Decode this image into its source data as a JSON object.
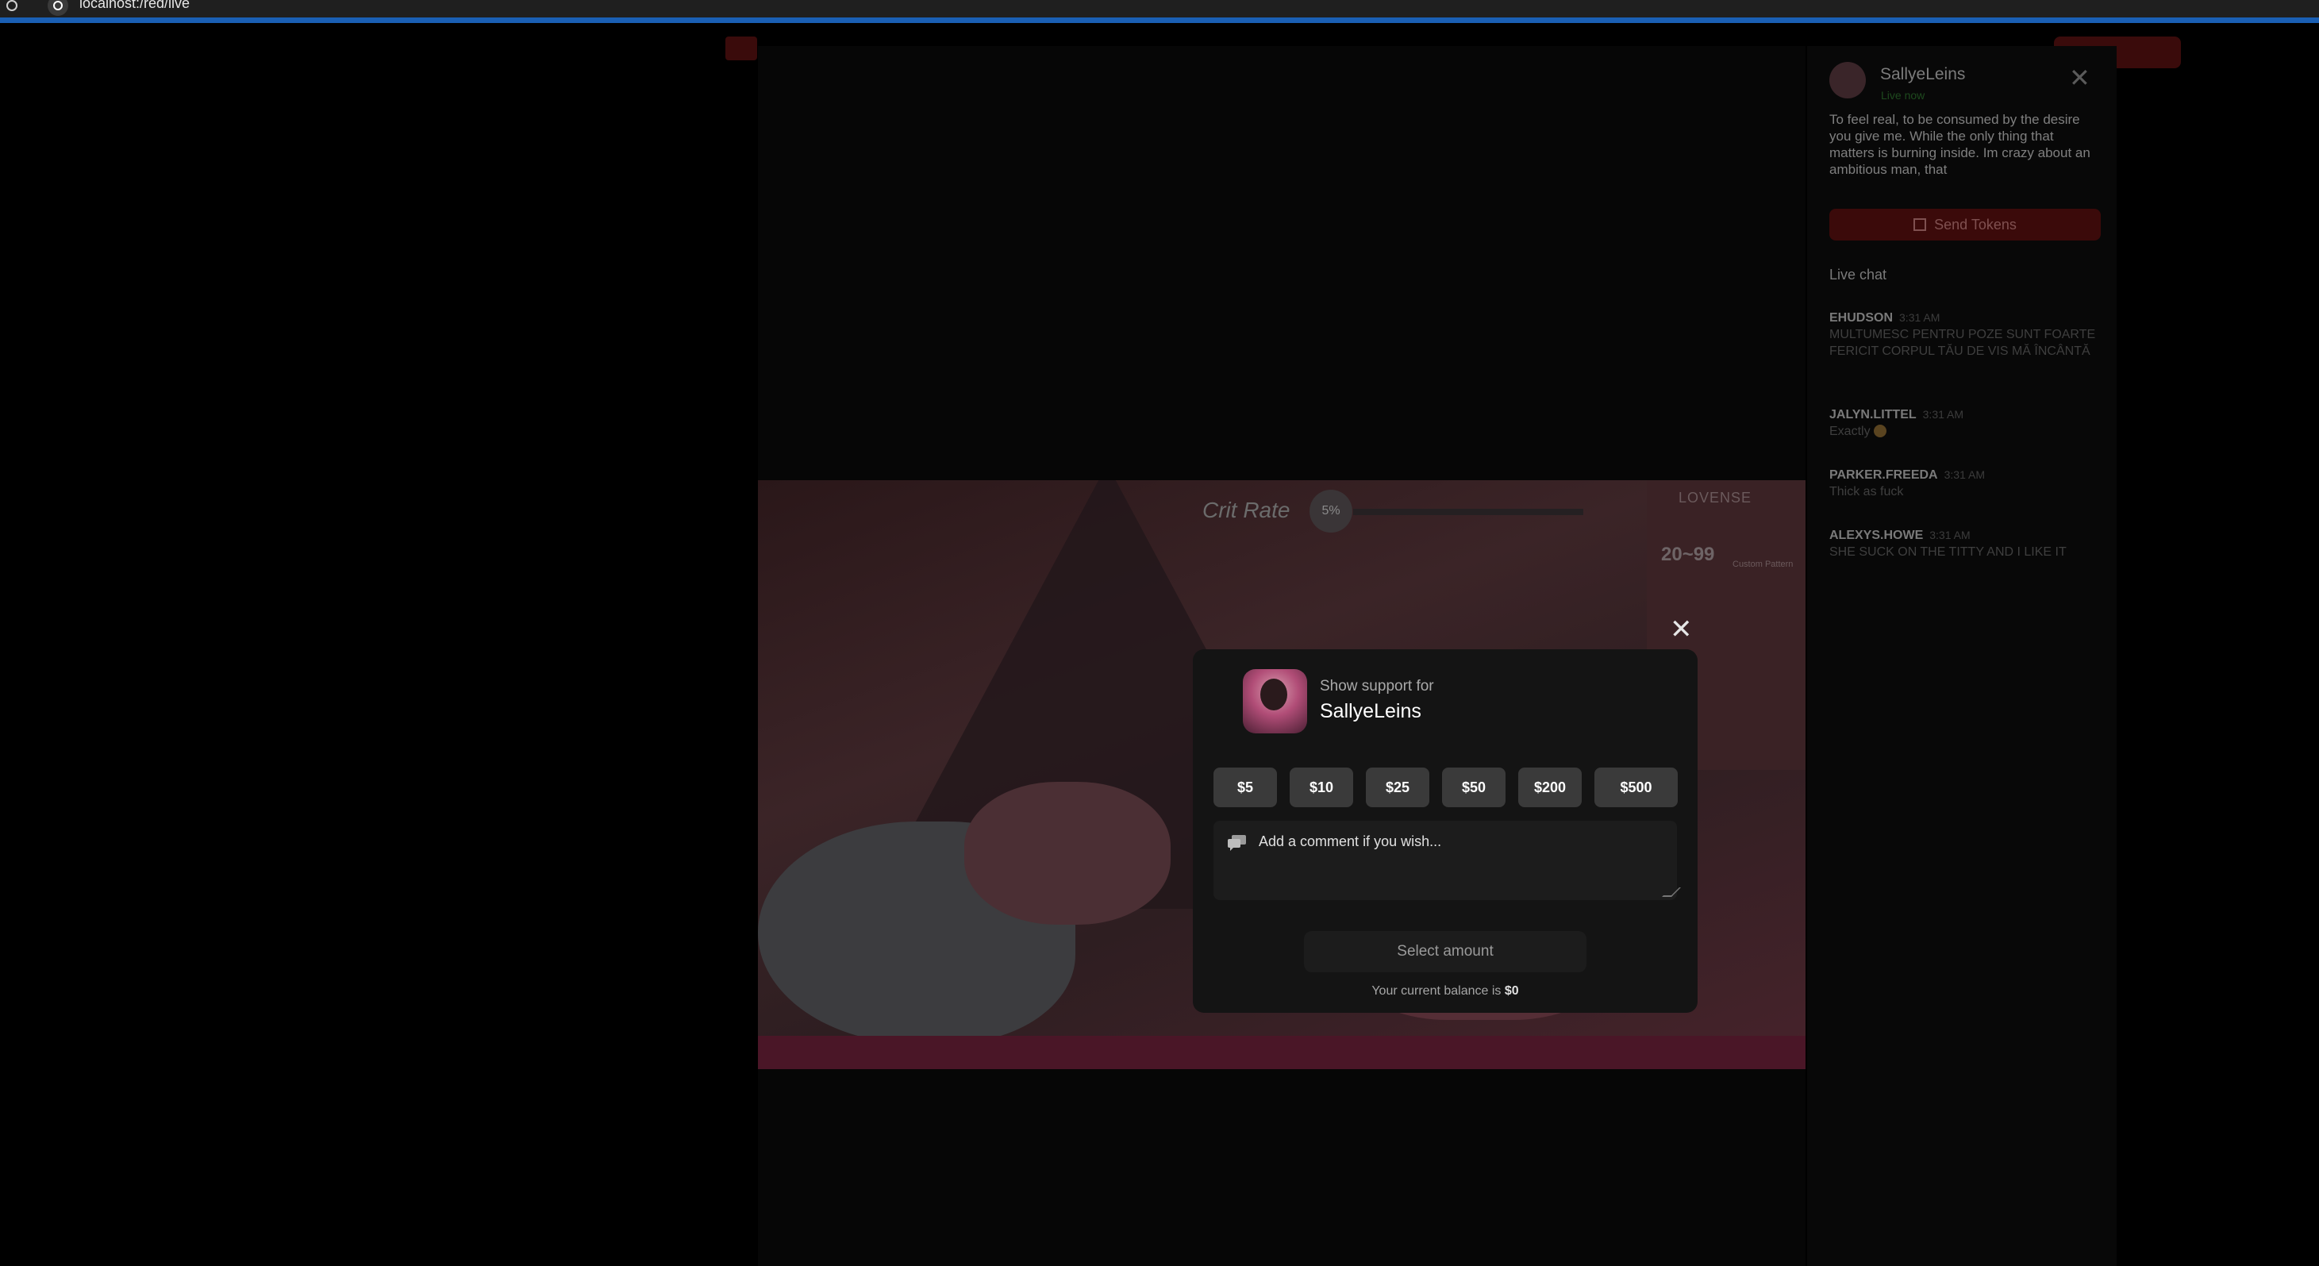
{
  "browser": {
    "url": "localhost:/red/live"
  },
  "sidebar": {
    "model_name": "SallyeLeins",
    "status": "Live now",
    "bio": "To feel real, to be consumed by the desire you give me. While the only thing that matters is burning inside. Im crazy about an ambitious man, that",
    "send_tokens_label": "Send Tokens",
    "live_chat_label": "Live chat",
    "messages": [
      {
        "user": "EHUDSON",
        "time": "3:31 AM",
        "text": "MULTUMESC PENTRU POZE SUNT FOARTE FERICIT CORPUL TĂU DE VIS MĂ ÎNCÂNTĂ"
      },
      {
        "user": "JALYN.LITTEL",
        "time": "3:31 AM",
        "text": "Exactly"
      },
      {
        "user": "PARKER.FREEDA",
        "time": "3:31 AM",
        "text": "Thick as fuck"
      },
      {
        "user": "ALEXYS.HOWE",
        "time": "3:31 AM",
        "text": "SHE SUCK ON THE TITTY AND I LIKE IT"
      }
    ]
  },
  "video_overlay": {
    "crit_label": "Crit Rate",
    "crit_value": "5%",
    "lovense_title": "LOVENSE",
    "lovense_range": "20~99",
    "lovense_sub": "Custom Pattern"
  },
  "modal": {
    "support_label": "Show support for",
    "model_name": "SallyeLeins",
    "amounts": [
      "$5",
      "$10",
      "$25",
      "$50",
      "$200",
      "$500"
    ],
    "comment_placeholder": "Add a comment if you wish...",
    "select_label": "Select amount",
    "balance_prefix": "Your current balance is",
    "balance_value": "$0"
  },
  "colors": {
    "accent": "#3b0a0a",
    "modal_bg": "#141414",
    "amount_bg": "#3a3a3a",
    "progress_blue": "#1a5fb4"
  },
  "icons": [
    "reload-icon",
    "site-icon",
    "close-icon",
    "gift-icon",
    "comment-icon"
  ]
}
